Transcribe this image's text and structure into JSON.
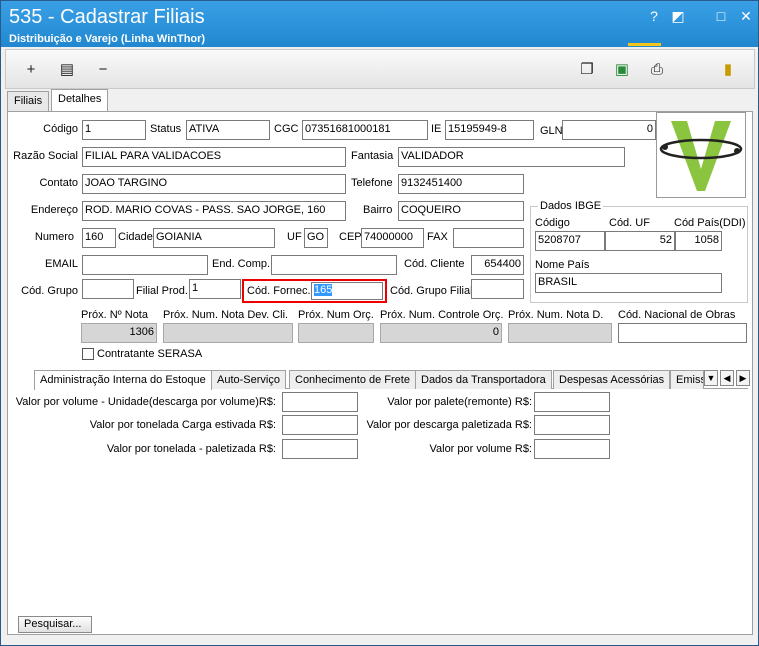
{
  "window": {
    "title": "535 - Cadastrar Filiais",
    "subtitle": "Distribuição e Varejo (Linha WinThor)",
    "help": "?",
    "restore": "◩",
    "minimize": "□",
    "close": "✕"
  },
  "tabs": {
    "filiais": "Filiais",
    "detalhes": "Detalhes"
  },
  "form": {
    "codigo_label": "Código",
    "codigo": "1",
    "status_label": "Status",
    "status": "ATIVA",
    "cgc_label": "CGC",
    "cgc": "07351681000181",
    "ie_label": "IE",
    "ie": "15195949-8",
    "gln_label": "GLN",
    "gln": "0",
    "razao_label": "Razão Social",
    "razao": "FILIAL PARA VALIDACOES",
    "fantasia_label": "Fantasia",
    "fantasia": "VALIDADOR",
    "contato_label": "Contato",
    "contato": "JOAO TARGINO",
    "telefone_label": "Telefone",
    "telefone": "9132451400",
    "endereco_label": "Endereço",
    "endereco": "ROD. MARIO COVAS - PASS. SAO JORGE, 160",
    "bairro_label": "Bairro",
    "bairro": "COQUEIRO",
    "numero_label": "Numero",
    "numero": "160",
    "cidade_label": "Cidade",
    "cidade": "GOIANIA",
    "uf_label": "UF",
    "uf": "GO",
    "cep_label": "CEP",
    "cep": "74000000",
    "fax_label": "FAX",
    "fax": "",
    "email_label": "EMAIL",
    "email": "",
    "comp_label": "End. Comp.",
    "comp": "",
    "cod_cliente_label": "Cód. Cliente",
    "cod_cliente": "654400",
    "cod_grupo_label": "Cód. Grupo",
    "cod_grupo": "",
    "filial_prod_label": "Filial Prod.",
    "filial_prod": "1",
    "cod_fornec_label": "Cód. Fornec.",
    "cod_fornec": "165",
    "cod_grupo_filial_label": "Cód. Grupo Filial",
    "cod_grupo_filial": ""
  },
  "ibge": {
    "title": "Dados IBGE",
    "codigo_label": "Código",
    "codigo": "5208707",
    "cod_uf_label": "Cód. UF",
    "cod_uf": "52",
    "cod_pais_label": "Cód País(DDI)",
    "cod_pais": "1058",
    "nome_pais_label": "Nome País",
    "nome_pais": "BRASIL"
  },
  "prox": {
    "nota_label": "Próx. Nº Nota",
    "nota": "1306",
    "nota_dev_label": "Próx. Num. Nota Dev. Cli.",
    "nota_dev": "",
    "orc_label": "Próx. Num Orç.",
    "orc": "",
    "controle_label": "Próx. Num. Controle Orç.",
    "controle": "0",
    "nota_d_label": "Próx. Num. Nota D.",
    "nota_d": "",
    "obras_label": "Cód. Nacional de Obras",
    "obras": ""
  },
  "serasa_label": "Contratante SERASA",
  "subtabs": [
    "Administração Interna do Estoque",
    "Auto-Serviço",
    "Conhecimento de Frete",
    "Dados da Transportadora",
    "Despesas Acessórias",
    "Emiss"
  ],
  "estoque": {
    "l1": "Valor por volume - Unidade(descarga por volume)R$:",
    "l2": "Valor por tonelada Carga estivada R$:",
    "l3": "Valor por tonelada - paletizada R$:",
    "r1": "Valor por palete(remonte) R$:",
    "r2": "Valor por descarga paletizada R$:",
    "r3": "Valor por volume R$:"
  },
  "pesquisar": "Pesquisar..."
}
